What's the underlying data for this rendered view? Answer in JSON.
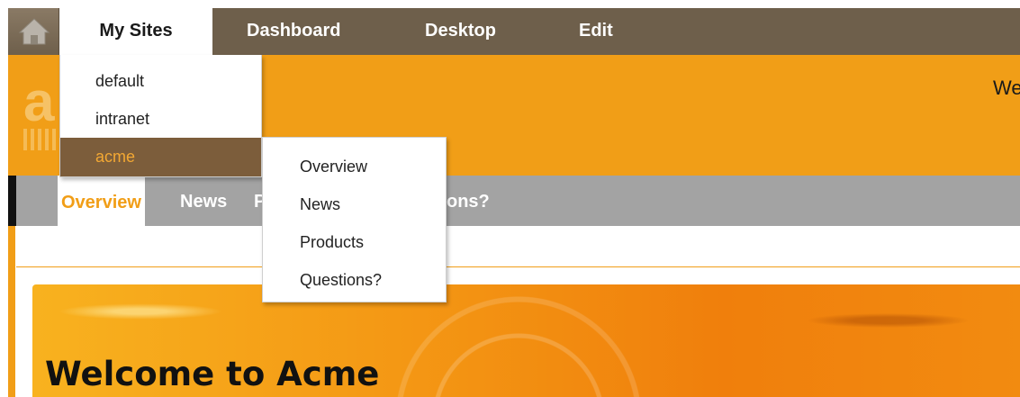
{
  "dock": {
    "home_icon": "home-icon",
    "tabs": [
      {
        "label": "My Sites",
        "active": true
      },
      {
        "label": "Dashboard",
        "active": false
      },
      {
        "label": "Desktop",
        "active": false
      },
      {
        "label": "Edit",
        "active": false
      }
    ]
  },
  "header": {
    "logo_letter": "a",
    "welcome_partial": "We"
  },
  "site_nav": {
    "items": [
      {
        "label": "Overview",
        "active": true
      },
      {
        "label": "News",
        "active": false
      },
      {
        "label": "P",
        "active": false
      },
      {
        "label": "ons?",
        "active": false
      }
    ]
  },
  "sites_menu": {
    "items": [
      {
        "label": "default",
        "selected": false
      },
      {
        "label": "intranet",
        "selected": false
      },
      {
        "label": "acme",
        "selected": true
      }
    ]
  },
  "acme_menu": {
    "items": [
      {
        "label": "Overview"
      },
      {
        "label": "News"
      },
      {
        "label": "Products"
      },
      {
        "label": "Questions?"
      }
    ]
  },
  "banner": {
    "title": "Welcome to Acme"
  },
  "colors": {
    "dock": "#6e5f4b",
    "brand_orange": "#f19e17",
    "menu_selected": "#7c5d3b",
    "nav_gray": "#a3a3a3"
  }
}
